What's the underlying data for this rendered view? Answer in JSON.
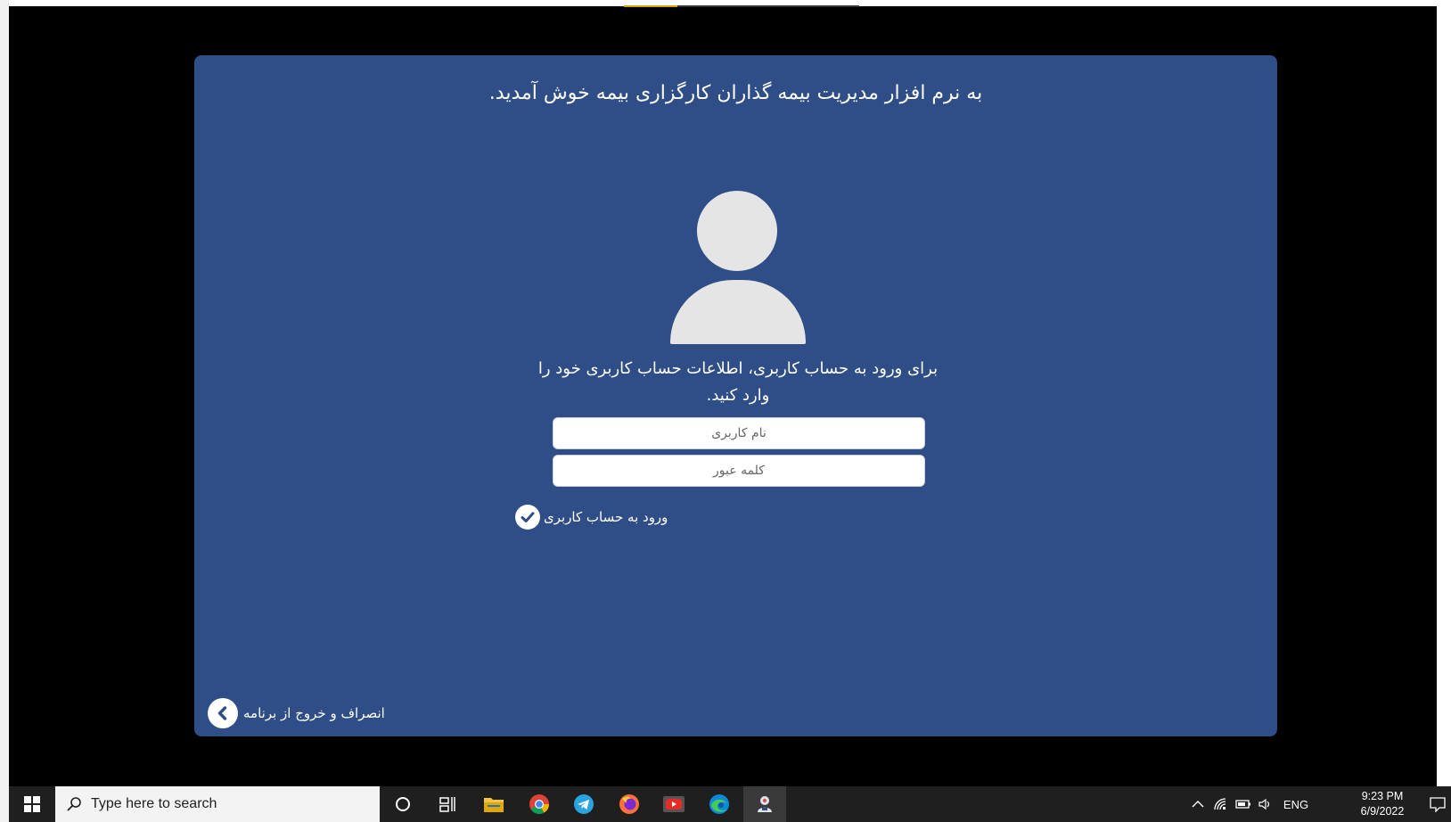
{
  "app": {
    "welcome_title": "به نرم افزار مدیریت بیمه گذاران کارگزاری بیمه خوش آمدید.",
    "login_prompt": "برای ورود به حساب کاربری، اطلاعات حساب کاربری خود را وارد کنید.",
    "username_placeholder": "نام کاربری",
    "password_placeholder": "کلمه عبور",
    "login_button_label": "ورود به حساب کاربری",
    "exit_button_label": "انصراف و خروج از برنامه",
    "panel_color": "#2f4d87"
  },
  "taskbar": {
    "search_placeholder": "Type here to search",
    "apps": [
      "cortana-icon",
      "task-view-icon",
      "file-explorer-icon",
      "chrome-icon",
      "telegram-icon",
      "firefox-icon",
      "youtube-icon",
      "edge-icon",
      "insurance-app-icon"
    ],
    "tray": {
      "language": "ENG",
      "time": "9:23 PM",
      "date": "6/9/2022"
    }
  }
}
